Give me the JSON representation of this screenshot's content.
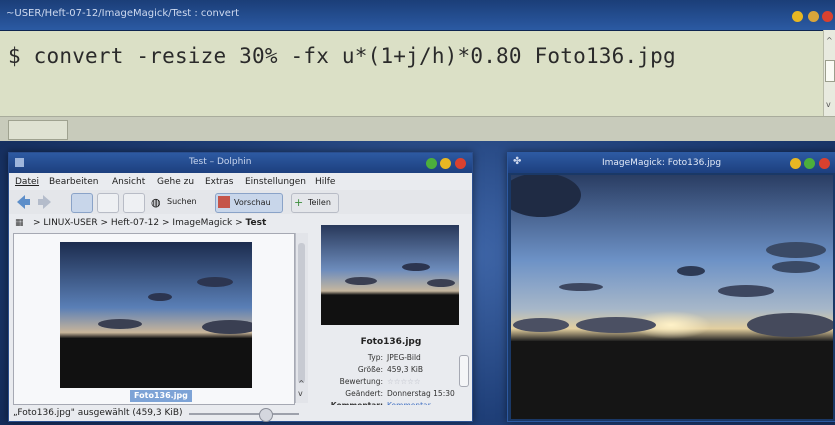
{
  "terminal": {
    "title": "~USER/Heft-07-12/ImageMagick/Test : convert",
    "command": "$ convert -resize 30% -fx u*(1+j/h)*0.80 Foto136.jpg"
  },
  "file_manager": {
    "title": "Test – Dolphin",
    "menu": [
      "Datei",
      "Bearbeiten",
      "Ansicht",
      "Gehe zu",
      "Extras",
      "Einstellungen",
      "Hilfe"
    ],
    "toolbar": {
      "search_label": "Suchen",
      "preview_label": "Vorschau",
      "split_label": "Teilen"
    },
    "breadcrumb": [
      "LINUX-USER",
      "Heft-07-12",
      "ImageMagick",
      "Test"
    ],
    "selected_file_label": "Foto136.jpg",
    "status_text": "„Foto136.jpg\" ausgewählt (459,3 KiB)",
    "preview": {
      "file_name": "Foto136.jpg",
      "meta": [
        {
          "key": "Typ:",
          "value": "JPEG-Bild"
        },
        {
          "key": "Größe:",
          "value": "459,3 KiB"
        },
        {
          "key": "Bewertung:",
          "value": "☆☆☆☆☆"
        },
        {
          "key": "Geändert:",
          "value": "Donnerstag 15:30"
        },
        {
          "key": "Kommentar:",
          "value": "Kommentar"
        }
      ]
    }
  },
  "imagemagick_window": {
    "title": "ImageMagick: Foto136.jpg"
  },
  "colors": {
    "window_red": "#d9412f",
    "window_yellow": "#e8b722",
    "window_green": "#4caf3b",
    "selection": "#7da3d6"
  }
}
